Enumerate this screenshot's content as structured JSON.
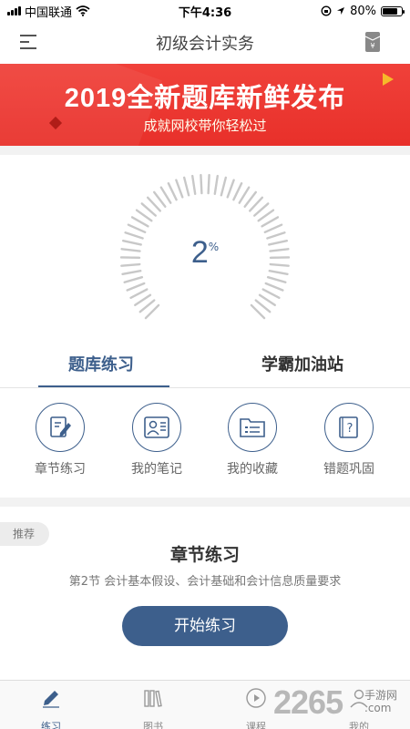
{
  "status_bar": {
    "carrier": "中国联通",
    "time": "下午4:36",
    "battery_text": "80%",
    "battery_level": 0.8
  },
  "nav": {
    "title": "初级会计实务",
    "menu_icon": "menu-icon",
    "wallet_icon": "yen-wallet-icon",
    "wallet_symbol": "¥"
  },
  "banner": {
    "title": "2019全新题库新鲜发布",
    "subtitle": "成就网校带你轻松过"
  },
  "progress": {
    "value": "2",
    "unit": "%"
  },
  "tabs": [
    {
      "label": "题库练习",
      "active": true
    },
    {
      "label": "学霸加油站",
      "active": false
    }
  ],
  "quick_actions": [
    {
      "label": "章节练习",
      "icon": "edit-document-icon"
    },
    {
      "label": "我的笔记",
      "icon": "notes-profile-icon"
    },
    {
      "label": "我的收藏",
      "icon": "folder-icon"
    },
    {
      "label": "错题巩固",
      "icon": "question-book-icon"
    }
  ],
  "recommend": {
    "tag": "推荐",
    "title": "章节练习",
    "description": "第2节  会计基本假设、会计基础和会计信息质量要求",
    "button": "开始练习"
  },
  "tabbar": [
    {
      "label": "练习",
      "icon": "pencil-icon",
      "active": true
    },
    {
      "label": "图书",
      "icon": "books-icon",
      "active": false
    },
    {
      "label": "课程",
      "icon": "play-icon",
      "active": false
    },
    {
      "label": "我的",
      "icon": "user-icon",
      "active": false
    }
  ],
  "watermark": {
    "number": "2265",
    "line1": "手游网",
    "line2": ".com"
  },
  "colors": {
    "accent": "#3d5f8c",
    "banner": "#ee3b33",
    "background": "#f2f2f2"
  }
}
